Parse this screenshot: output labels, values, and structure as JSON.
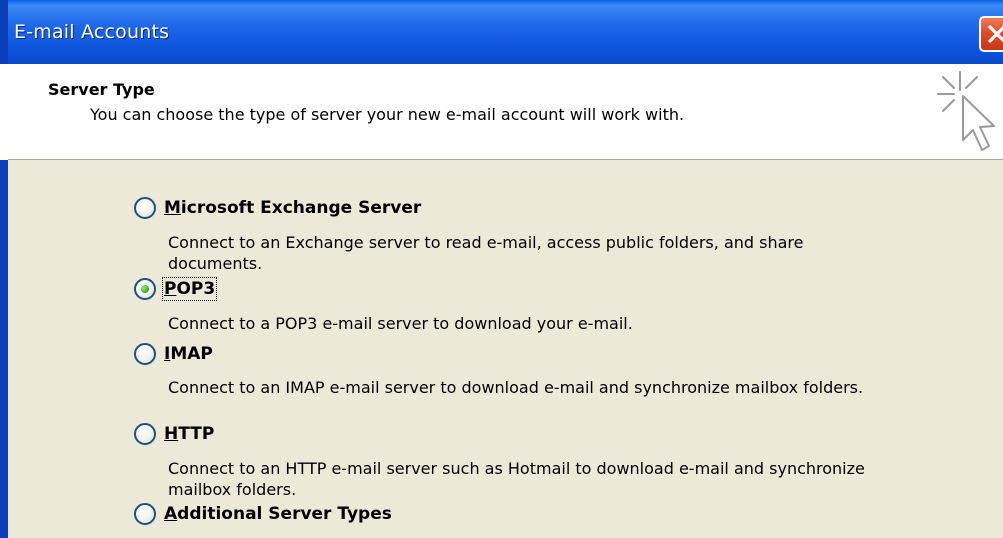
{
  "window": {
    "title": "E-mail Accounts"
  },
  "header": {
    "title": "Server Type",
    "description": "You can choose the type of server your new e-mail account will work with."
  },
  "icons": {
    "close": "close-icon",
    "wizard": "cursor-sparkle-icon"
  },
  "colors": {
    "titlebar": "#0a5ee6",
    "content_bg": "#ece9d8",
    "close_button": "#dc4a25",
    "radio_checked": "#3fae2a"
  },
  "server_types": {
    "selected": "POP3",
    "options": [
      {
        "access_key": "M",
        "label_rest": "icrosoft Exchange Server",
        "label": "Microsoft Exchange Server",
        "description": "Connect to an Exchange server to read e-mail, access public folders, and share documents."
      },
      {
        "access_key": "P",
        "label_rest": "OP3",
        "label": "POP3",
        "description": "Connect to a POP3 e-mail server to download your e-mail."
      },
      {
        "access_key": "I",
        "label_rest": "MAP",
        "label": "IMAP",
        "description": "Connect to an IMAP e-mail server to download e-mail and synchronize mailbox folders."
      },
      {
        "access_key": "H",
        "label_rest": "TTP",
        "label": "HTTP",
        "description": "Connect to an HTTP e-mail server such as Hotmail to download e-mail and synchronize mailbox folders."
      },
      {
        "access_key": "A",
        "label_rest": "dditional Server Types",
        "label": "Additional Server Types",
        "description": ""
      }
    ]
  }
}
